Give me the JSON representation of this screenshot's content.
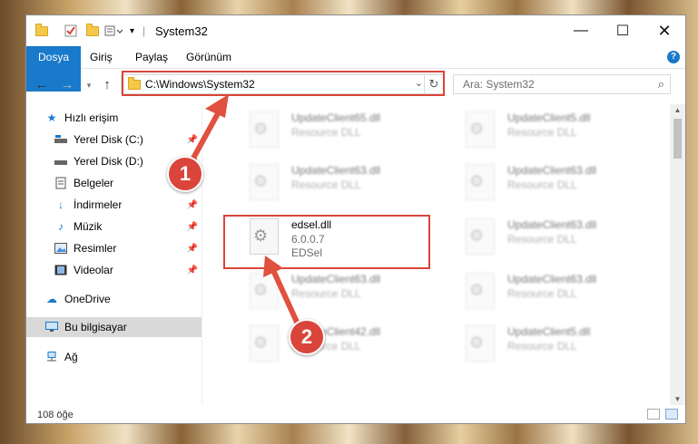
{
  "window": {
    "title": "System32"
  },
  "ribbon": {
    "tabs": [
      "Dosya",
      "Giriş",
      "Paylaş",
      "Görünüm"
    ],
    "help": "?"
  },
  "address": {
    "path": "C:\\Windows\\System32",
    "search_placeholder": "Ara: System32"
  },
  "sidebar": {
    "items": [
      {
        "label": "Hızlı erişim",
        "icon": "star-icon"
      },
      {
        "label": "Yerel Disk (C:)",
        "icon": "drive-icon"
      },
      {
        "label": "Yerel Disk (D:)",
        "icon": "drive-icon"
      },
      {
        "label": "Belgeler",
        "icon": "documents-icon"
      },
      {
        "label": "İndirmeler",
        "icon": "download-icon"
      },
      {
        "label": "Müzik",
        "icon": "music-icon"
      },
      {
        "label": "Resimler",
        "icon": "pictures-icon"
      },
      {
        "label": "Videolar",
        "icon": "video-icon"
      },
      {
        "label": "OneDrive",
        "icon": "cloud-icon"
      },
      {
        "label": "Bu bilgisayar",
        "icon": "computer-icon"
      },
      {
        "label": "Ağ",
        "icon": "network-icon"
      }
    ]
  },
  "files": [
    {
      "name": "UpdateClient65.dll",
      "line2": "Resource DLL",
      "line3": ""
    },
    {
      "name": "UpdateClient5.dll",
      "line2": "Resource DLL",
      "line3": ""
    },
    {
      "name": "UpdateClient63.dll",
      "line2": "Resource DLL",
      "line3": ""
    },
    {
      "name": "UpdateClient63.dll",
      "line2": "Resource DLL",
      "line3": ""
    },
    {
      "name": "edsel.dll",
      "line2": "6.0.0.7",
      "line3": "EDSel"
    },
    {
      "name": "UpdateClient63.dll",
      "line2": "Resource DLL",
      "line3": ""
    },
    {
      "name": "UpdateClient63.dll",
      "line2": "Resource DLL",
      "line3": ""
    },
    {
      "name": "UpdateClient63.dll",
      "line2": "Resource DLL",
      "line3": ""
    },
    {
      "name": "UpdateClient42.dll",
      "line2": "Resource DLL",
      "line3": ""
    },
    {
      "name": "UpdateClient5.dll",
      "line2": "Resource DLL",
      "line3": ""
    }
  ],
  "status": {
    "count": "108 öğe"
  },
  "callouts": [
    "1",
    "2"
  ],
  "colors": {
    "accent": "#1979ca",
    "highlight": "#d9453a"
  }
}
